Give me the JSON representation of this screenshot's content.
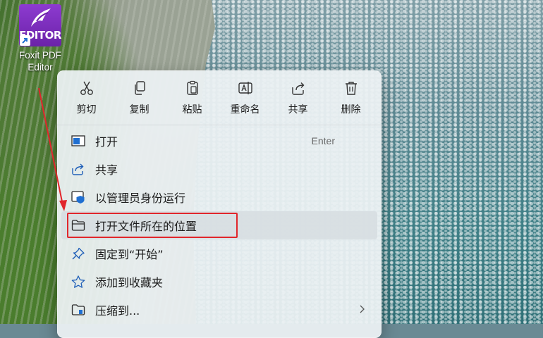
{
  "desktop": {
    "shortcut": {
      "brand_text": "EDITOR",
      "label_line1": "Foxit PDF",
      "label_line2": "Editor",
      "icon": "foxit-pdf-editor-app-icon"
    }
  },
  "colors": {
    "annotation_red": "#e1262b",
    "menu_bg": "#ecf1f3",
    "accent_blue": "#1f6fd1"
  },
  "context_menu": {
    "toolbar": [
      {
        "label": "剪切",
        "icon": "cut-icon"
      },
      {
        "label": "复制",
        "icon": "copy-icon"
      },
      {
        "label": "粘贴",
        "icon": "paste-icon"
      },
      {
        "label": "重命名",
        "icon": "rename-icon"
      },
      {
        "label": "共享",
        "icon": "share-icon"
      },
      {
        "label": "删除",
        "icon": "delete-icon"
      }
    ],
    "items": [
      {
        "label": "打开",
        "accelerator": "Enter",
        "icon": "open-window-icon"
      },
      {
        "label": "共享",
        "icon": "share-icon"
      },
      {
        "label": "以管理员身份运行",
        "icon": "admin-shield-icon"
      },
      {
        "label": "打开文件所在的位置",
        "icon": "folder-icon",
        "highlighted": true
      },
      {
        "label": "固定到“开始”",
        "icon": "pin-icon"
      },
      {
        "label": "添加到收藏夹",
        "icon": "star-icon"
      },
      {
        "label": "压缩到...",
        "icon": "zip-folder-icon",
        "has_submenu": true
      }
    ]
  }
}
